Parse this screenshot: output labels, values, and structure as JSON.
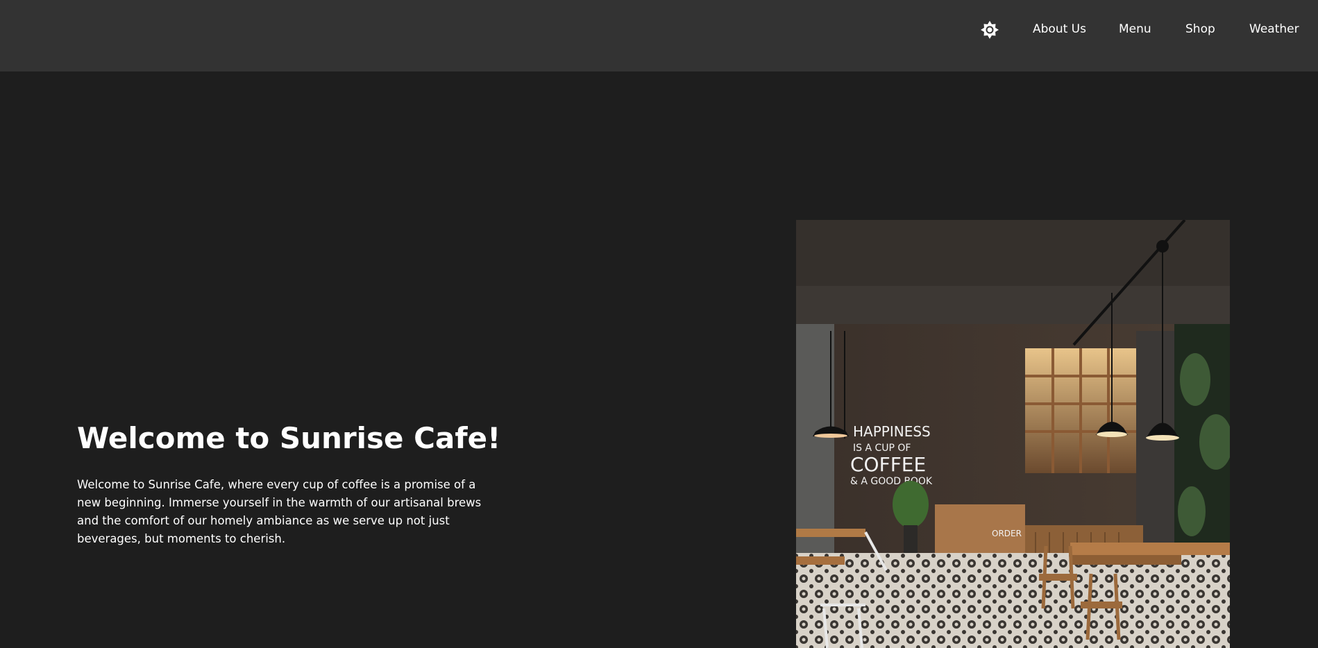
{
  "nav": {
    "theme_icon": "sun-icon",
    "links": [
      "About Us",
      "Menu",
      "Shop",
      "Weather"
    ]
  },
  "hero": {
    "title": "Welcome to Sunrise Cafe!",
    "description": "Welcome to Sunrise Cafe, where every cup of coffee is a promise of a new beginning. Immerse yourself in the warmth of our artisanal brews and the comfort of our homely ambiance as we serve up not just beverages, but moments to cherish.",
    "image": {
      "sign_line1": "HAPPINESS",
      "sign_line2": "IS A CUP OF",
      "sign_line3": "COFFEE",
      "sign_line4": "& A GOOD BOOK",
      "counter_label": "ORDER"
    }
  },
  "colors": {
    "navbar_bg": "#333333",
    "page_bg": "#1e1e1e",
    "text": "#ffffff"
  }
}
